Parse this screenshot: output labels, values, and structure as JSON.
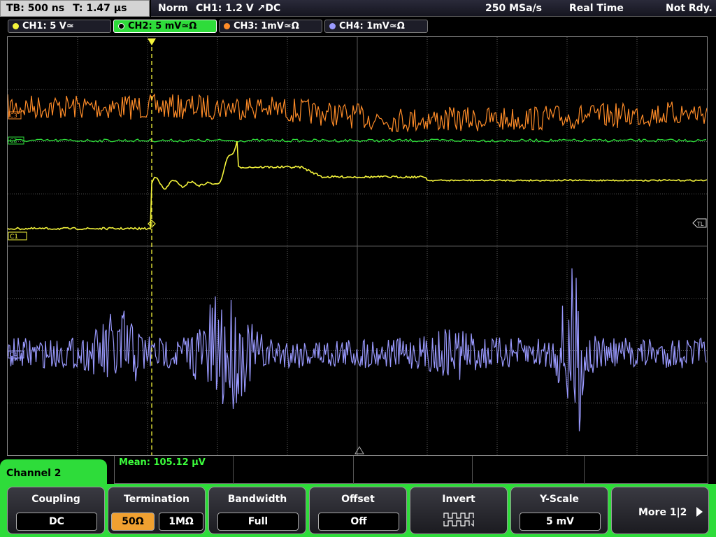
{
  "top_bar": {
    "timebase": "TB: 500 ns",
    "trigger_time": "T: 1.47 µs",
    "mode": "Norm",
    "trigger_source": "CH1: 1.2 V ↗DC",
    "sample_rate": "250 MSa/s",
    "acq_mode": "Real Time",
    "status": "Not Rdy."
  },
  "channels": [
    {
      "label": "CH1: 5 V≃",
      "color": "#f5f53c",
      "selected": false
    },
    {
      "label": "CH2: 5 mV≃Ω",
      "color": "#2edc3a",
      "selected": true
    },
    {
      "label": "CH3: 1mV≃Ω",
      "color": "#ff8c28",
      "selected": false
    },
    {
      "label": "CH4: 1mV≃Ω",
      "color": "#9a9aff",
      "selected": false
    }
  ],
  "markers": {
    "c3": "C3",
    "c2": "C2",
    "c1": "C1",
    "c4": "C4",
    "trigger_level": "TL"
  },
  "colors": {
    "ch1": "#f5f53c",
    "ch2": "#2edc3a",
    "ch3": "#ff8c28",
    "ch4": "#9a9aff",
    "grid": "#5a5a5a",
    "trigger_line": "#f5f53c",
    "accent": "#2edc3a"
  },
  "measurement": {
    "mean": "Mean: 105.12 µV"
  },
  "channel_menu": {
    "title": "Channel 2"
  },
  "softkeys": {
    "coupling": {
      "title": "Coupling",
      "value": "DC"
    },
    "termination": {
      "title": "Termination",
      "option_a": "50Ω",
      "option_b": "1MΩ",
      "active": "option_a"
    },
    "bandwidth": {
      "title": "Bandwidth",
      "value": "Full"
    },
    "offset": {
      "title": "Offset",
      "value": "Off"
    },
    "invert": {
      "title": "Invert",
      "icon": "square-wave-invert-icon"
    },
    "y_scale": {
      "title": "Y-Scale",
      "value": "5 mV"
    },
    "more": {
      "label": "More 1|2",
      "icon": "chevron-right-icon"
    }
  }
}
